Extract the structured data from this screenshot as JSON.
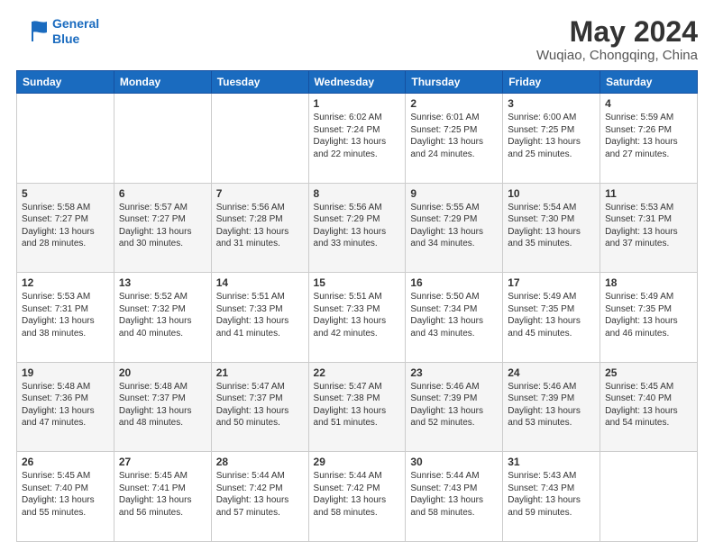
{
  "header": {
    "logo_line1": "General",
    "logo_line2": "Blue",
    "main_title": "May 2024",
    "subtitle": "Wuqiao, Chongqing, China"
  },
  "days_of_week": [
    "Sunday",
    "Monday",
    "Tuesday",
    "Wednesday",
    "Thursday",
    "Friday",
    "Saturday"
  ],
  "weeks": [
    [
      {
        "day": "",
        "info": ""
      },
      {
        "day": "",
        "info": ""
      },
      {
        "day": "",
        "info": ""
      },
      {
        "day": "1",
        "info": "Sunrise: 6:02 AM\nSunset: 7:24 PM\nDaylight: 13 hours\nand 22 minutes."
      },
      {
        "day": "2",
        "info": "Sunrise: 6:01 AM\nSunset: 7:25 PM\nDaylight: 13 hours\nand 24 minutes."
      },
      {
        "day": "3",
        "info": "Sunrise: 6:00 AM\nSunset: 7:25 PM\nDaylight: 13 hours\nand 25 minutes."
      },
      {
        "day": "4",
        "info": "Sunrise: 5:59 AM\nSunset: 7:26 PM\nDaylight: 13 hours\nand 27 minutes."
      }
    ],
    [
      {
        "day": "5",
        "info": "Sunrise: 5:58 AM\nSunset: 7:27 PM\nDaylight: 13 hours\nand 28 minutes."
      },
      {
        "day": "6",
        "info": "Sunrise: 5:57 AM\nSunset: 7:27 PM\nDaylight: 13 hours\nand 30 minutes."
      },
      {
        "day": "7",
        "info": "Sunrise: 5:56 AM\nSunset: 7:28 PM\nDaylight: 13 hours\nand 31 minutes."
      },
      {
        "day": "8",
        "info": "Sunrise: 5:56 AM\nSunset: 7:29 PM\nDaylight: 13 hours\nand 33 minutes."
      },
      {
        "day": "9",
        "info": "Sunrise: 5:55 AM\nSunset: 7:29 PM\nDaylight: 13 hours\nand 34 minutes."
      },
      {
        "day": "10",
        "info": "Sunrise: 5:54 AM\nSunset: 7:30 PM\nDaylight: 13 hours\nand 35 minutes."
      },
      {
        "day": "11",
        "info": "Sunrise: 5:53 AM\nSunset: 7:31 PM\nDaylight: 13 hours\nand 37 minutes."
      }
    ],
    [
      {
        "day": "12",
        "info": "Sunrise: 5:53 AM\nSunset: 7:31 PM\nDaylight: 13 hours\nand 38 minutes."
      },
      {
        "day": "13",
        "info": "Sunrise: 5:52 AM\nSunset: 7:32 PM\nDaylight: 13 hours\nand 40 minutes."
      },
      {
        "day": "14",
        "info": "Sunrise: 5:51 AM\nSunset: 7:33 PM\nDaylight: 13 hours\nand 41 minutes."
      },
      {
        "day": "15",
        "info": "Sunrise: 5:51 AM\nSunset: 7:33 PM\nDaylight: 13 hours\nand 42 minutes."
      },
      {
        "day": "16",
        "info": "Sunrise: 5:50 AM\nSunset: 7:34 PM\nDaylight: 13 hours\nand 43 minutes."
      },
      {
        "day": "17",
        "info": "Sunrise: 5:49 AM\nSunset: 7:35 PM\nDaylight: 13 hours\nand 45 minutes."
      },
      {
        "day": "18",
        "info": "Sunrise: 5:49 AM\nSunset: 7:35 PM\nDaylight: 13 hours\nand 46 minutes."
      }
    ],
    [
      {
        "day": "19",
        "info": "Sunrise: 5:48 AM\nSunset: 7:36 PM\nDaylight: 13 hours\nand 47 minutes."
      },
      {
        "day": "20",
        "info": "Sunrise: 5:48 AM\nSunset: 7:37 PM\nDaylight: 13 hours\nand 48 minutes."
      },
      {
        "day": "21",
        "info": "Sunrise: 5:47 AM\nSunset: 7:37 PM\nDaylight: 13 hours\nand 50 minutes."
      },
      {
        "day": "22",
        "info": "Sunrise: 5:47 AM\nSunset: 7:38 PM\nDaylight: 13 hours\nand 51 minutes."
      },
      {
        "day": "23",
        "info": "Sunrise: 5:46 AM\nSunset: 7:39 PM\nDaylight: 13 hours\nand 52 minutes."
      },
      {
        "day": "24",
        "info": "Sunrise: 5:46 AM\nSunset: 7:39 PM\nDaylight: 13 hours\nand 53 minutes."
      },
      {
        "day": "25",
        "info": "Sunrise: 5:45 AM\nSunset: 7:40 PM\nDaylight: 13 hours\nand 54 minutes."
      }
    ],
    [
      {
        "day": "26",
        "info": "Sunrise: 5:45 AM\nSunset: 7:40 PM\nDaylight: 13 hours\nand 55 minutes."
      },
      {
        "day": "27",
        "info": "Sunrise: 5:45 AM\nSunset: 7:41 PM\nDaylight: 13 hours\nand 56 minutes."
      },
      {
        "day": "28",
        "info": "Sunrise: 5:44 AM\nSunset: 7:42 PM\nDaylight: 13 hours\nand 57 minutes."
      },
      {
        "day": "29",
        "info": "Sunrise: 5:44 AM\nSunset: 7:42 PM\nDaylight: 13 hours\nand 58 minutes."
      },
      {
        "day": "30",
        "info": "Sunrise: 5:44 AM\nSunset: 7:43 PM\nDaylight: 13 hours\nand 58 minutes."
      },
      {
        "day": "31",
        "info": "Sunrise: 5:43 AM\nSunset: 7:43 PM\nDaylight: 13 hours\nand 59 minutes."
      },
      {
        "day": "",
        "info": ""
      }
    ]
  ]
}
